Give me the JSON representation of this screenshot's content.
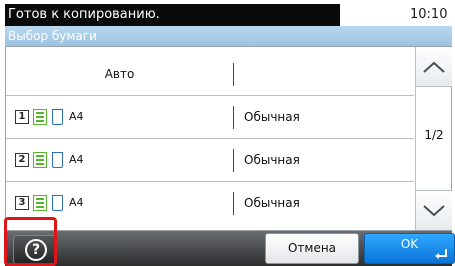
{
  "status": {
    "message": "Готов к копированию.",
    "time": "10:10"
  },
  "screen": {
    "title": "Выбор бумаги"
  },
  "paper_list": {
    "auto_label": "Авто",
    "trays": [
      {
        "number": "1",
        "size": "A4",
        "type": "Обычная"
      },
      {
        "number": "2",
        "size": "A4",
        "type": "Обычная"
      },
      {
        "number": "3",
        "size": "A4",
        "type": "Обычная"
      }
    ]
  },
  "pager": {
    "indicator": "1/2"
  },
  "icons": {
    "help": "help-icon",
    "scroll_up": "chevron-up-icon",
    "scroll_down": "chevron-down-icon",
    "enter": "enter-icon"
  },
  "actions": {
    "help_glyph": "?",
    "cancel": "Отмена",
    "ok": "OK"
  },
  "colors": {
    "ok_accent": "#1e90ff",
    "highlight": "#e0151a",
    "title_bar": "#a9cdea"
  }
}
